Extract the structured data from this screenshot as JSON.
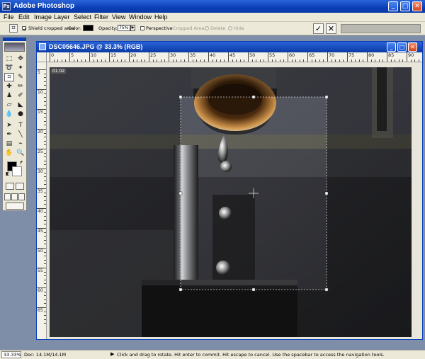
{
  "app": {
    "title": "Adobe Photoshop",
    "icon_label": "Ps",
    "window_controls": [
      "minimize-icon",
      "maximize-icon",
      "close-icon"
    ]
  },
  "menu": [
    "File",
    "Edit",
    "Image",
    "Layer",
    "Select",
    "Filter",
    "View",
    "Window",
    "Help"
  ],
  "options_bar": {
    "shield_label": "Shield cropped area",
    "shield_checked": true,
    "color_label": "Color:",
    "color_value": "#000000",
    "opacity_label": "Opacity:",
    "opacity_value": "75%",
    "perspective_label": "Perspective",
    "perspective_checked": false,
    "cropped_area_label": "Cropped Area:",
    "delete_label": "Delete",
    "hide_label": "Hide",
    "commit_icon": "checkmark-icon",
    "cancel_icon": "x-icon"
  },
  "document": {
    "title": "DSC05646.JPG @ 33.3% (RGB)",
    "layer_badge": "01  02",
    "ruler_labels": [
      "0",
      "5",
      "10",
      "15",
      "20",
      "25",
      "30",
      "35",
      "40",
      "45",
      "50",
      "55",
      "60",
      "65",
      "70",
      "75",
      "80",
      "85",
      "90"
    ],
    "vruler_labels": [
      "5",
      "10",
      "15",
      "20",
      "25",
      "30",
      "35",
      "40",
      "45",
      "50",
      "55",
      "60",
      "65"
    ]
  },
  "status_bar": {
    "zoom": "33.33%",
    "doc_size": "Doc: 14.1M/14.1M",
    "hint": "Click and drag to rotate. Hit enter to commit. Hit escape to cancel. Use the spacebar to access the navigation tools."
  }
}
